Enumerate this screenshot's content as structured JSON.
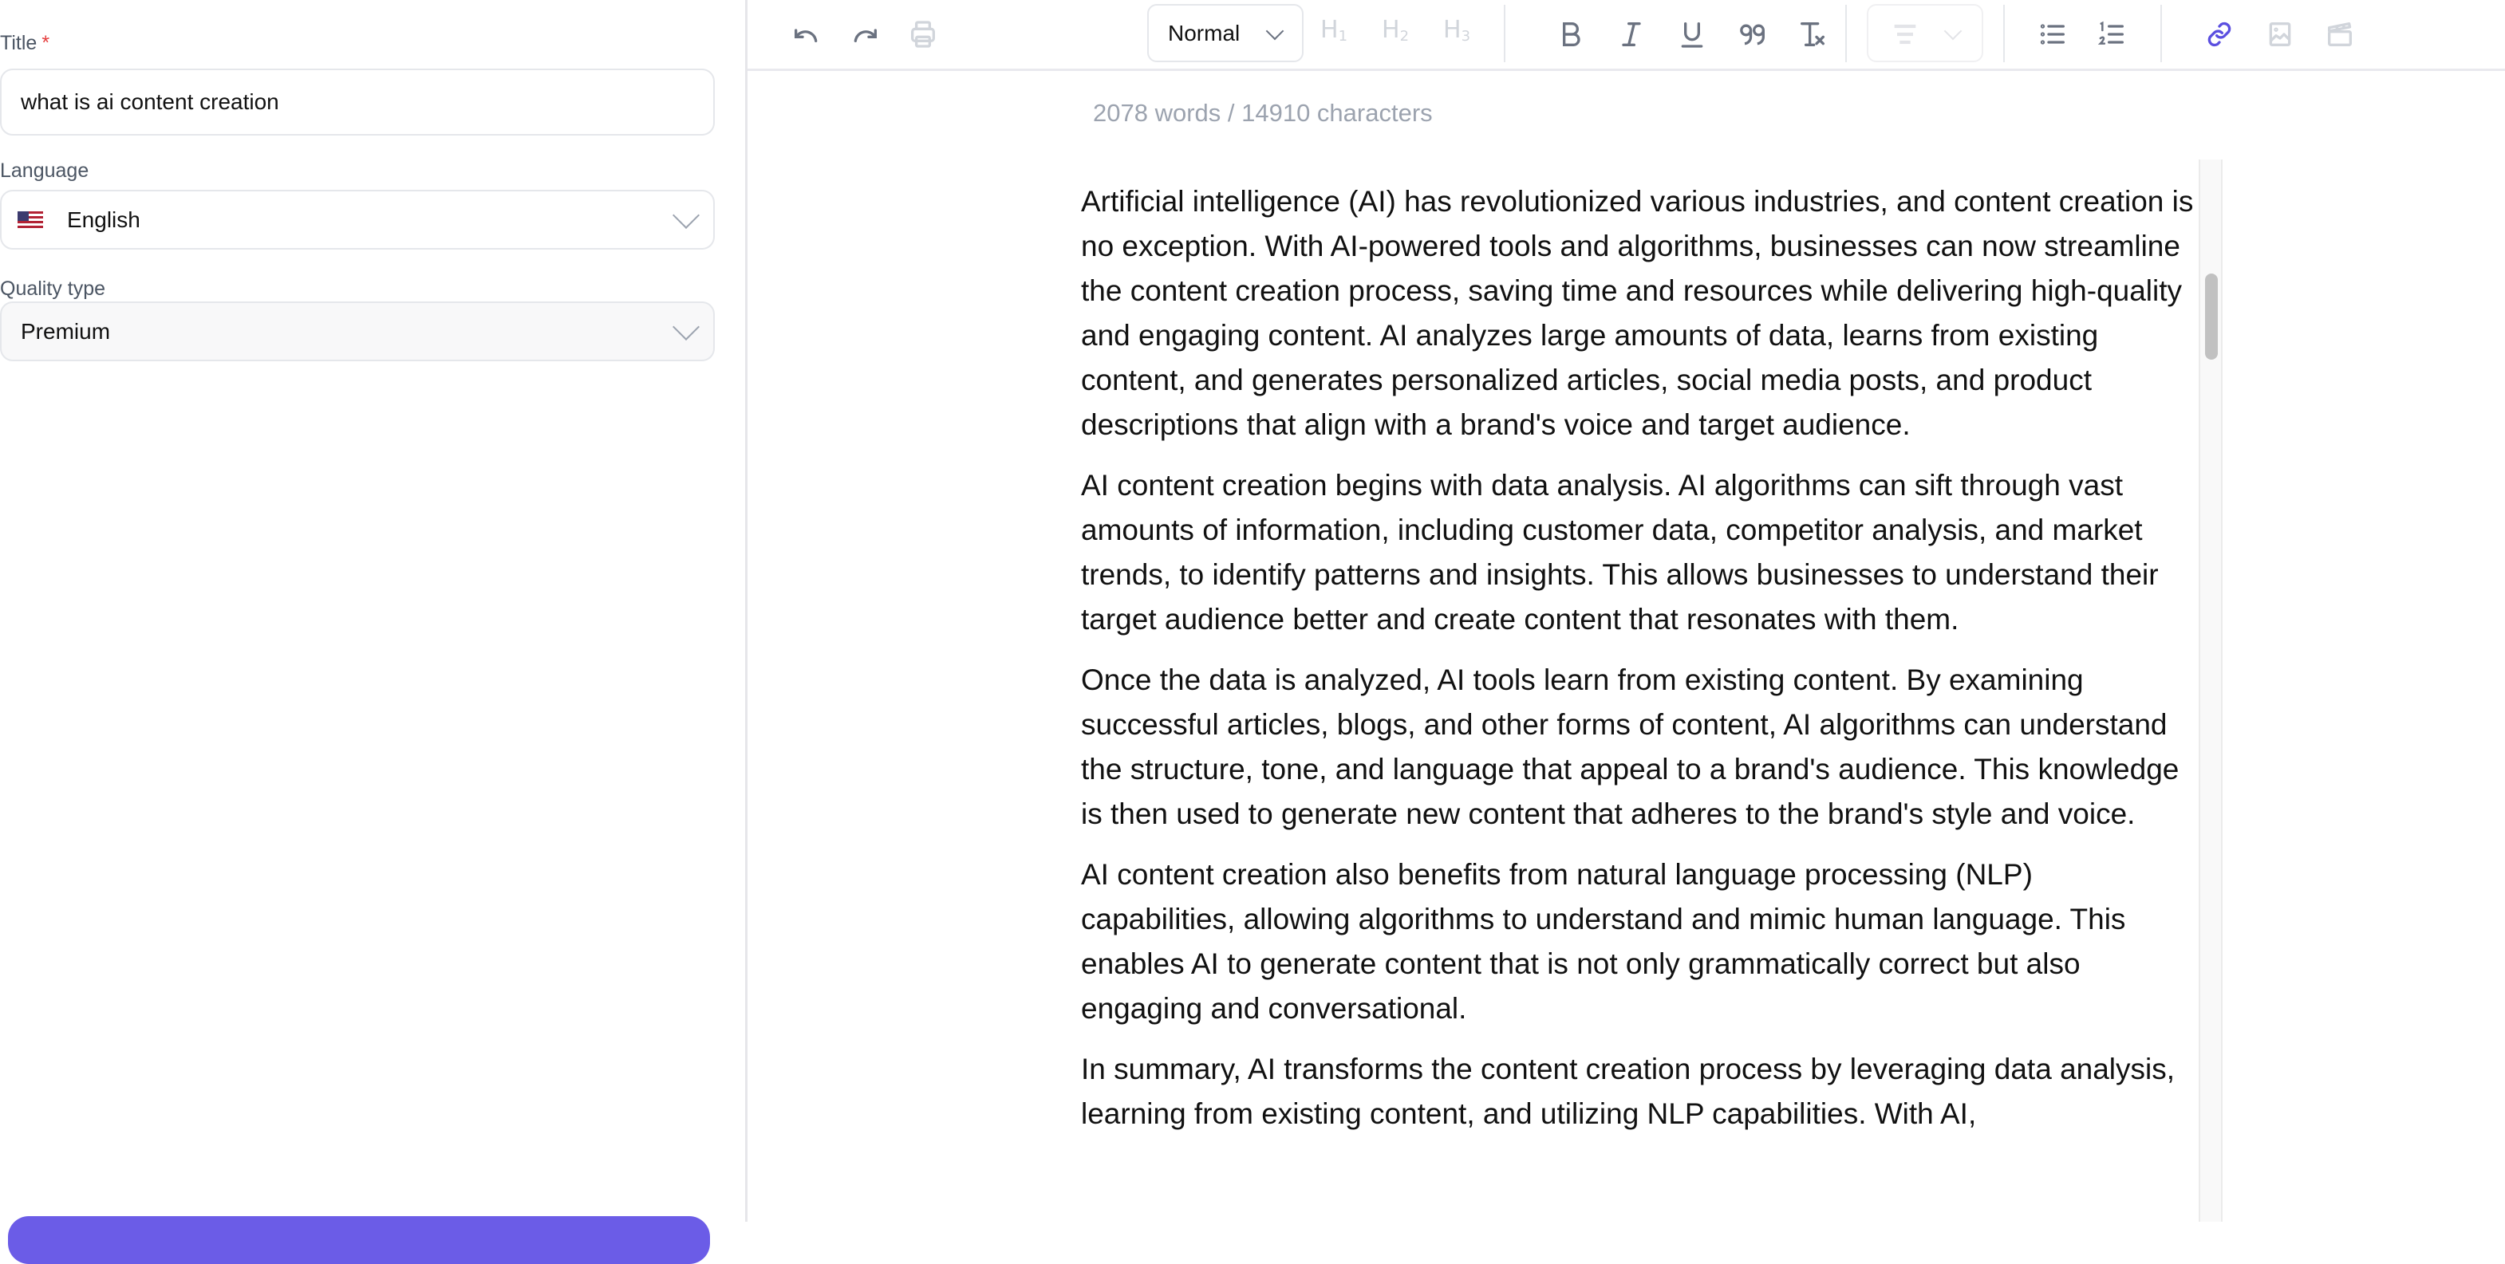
{
  "form": {
    "title_label": "Title",
    "title_required_mark": "*",
    "title_value": "what is ai content creation",
    "language_label": "Language",
    "language_value": "English",
    "language_flag": "us-flag-icon",
    "quality_label": "Quality type",
    "quality_value": "Premium"
  },
  "toolbar": {
    "undo": "undo-icon",
    "redo": "redo-icon",
    "print": "print-icon",
    "text_style": "Normal",
    "h1": "H",
    "h2": "H",
    "h3": "H",
    "h1_sub": "1",
    "h2_sub": "2",
    "h3_sub": "3",
    "bold": "B",
    "italic": "I",
    "underline": "U",
    "quote": "99",
    "clear_format": "Tx",
    "accent_color": "#5b4fe0"
  },
  "editor": {
    "word_count": "2078 words / 14910 characters",
    "paragraphs": [
      "Artificial intelligence (AI) has revolutionized various industries, and content creation is no exception. With AI-powered tools and algorithms, businesses can now streamline the content creation process, saving time and resources while delivering high-quality and engaging content. AI analyzes large amounts of data, learns from existing content, and generates personalized articles, social media posts, and product descriptions that align with a brand's voice and target audience.",
      "AI content creation begins with data analysis. AI algorithms can sift through vast amounts of information, including customer data, competitor analysis, and market trends, to identify patterns and insights. This allows businesses to understand their target audience better and create content that resonates with them.",
      "Once the data is analyzed, AI tools learn from existing content. By examining successful articles, blogs, and other forms of content, AI algorithms can understand the structure, tone, and language that appeal to a brand's audience. This knowledge is then used to generate new content that adheres to the brand's style and voice.",
      "AI content creation also benefits from natural language processing (NLP) capabilities, allowing algorithms to understand and mimic human language. This enables AI to generate content that is not only grammatically correct but also engaging and conversational.",
      "In summary, AI transforms the content creation process by leveraging data analysis, learning from existing content, and utilizing NLP capabilities. With AI,"
    ]
  },
  "colors": {
    "primary_button": "#6b5ce7",
    "required": "#e53e3e",
    "muted_text": "#9ca3af"
  }
}
